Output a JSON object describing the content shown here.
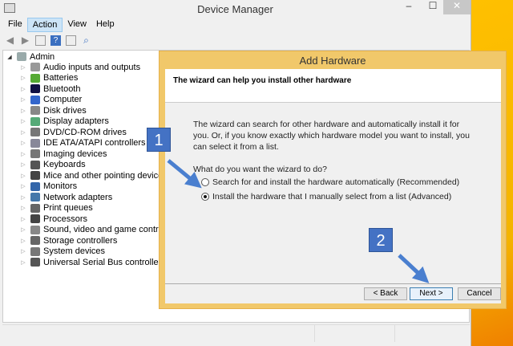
{
  "window": {
    "title": "Device Manager",
    "minimize": "–",
    "maximize": "☐",
    "close": "✕"
  },
  "menu": [
    "File",
    "Action",
    "View",
    "Help"
  ],
  "tree": {
    "root": "Admin",
    "items": [
      "Audio inputs and outputs",
      "Batteries",
      "Bluetooth",
      "Computer",
      "Disk drives",
      "Display adapters",
      "DVD/CD-ROM drives",
      "IDE ATA/ATAPI controllers",
      "Imaging devices",
      "Keyboards",
      "Mice and other pointing devices",
      "Monitors",
      "Network adapters",
      "Print queues",
      "Processors",
      "Sound, video and game controllers",
      "Storage controllers",
      "System devices",
      "Universal Serial Bus controllers"
    ]
  },
  "dialog": {
    "title": "Add Hardware",
    "header": "The wizard can help you install other hardware",
    "description": "The wizard can search for other hardware and automatically install it for you. Or, if you know exactly which hardware model you want to install, you can select it from a list.",
    "question": "What do you want the wizard to do?",
    "options": [
      {
        "label": "Search for and install the hardware automatically (Recommended)",
        "selected": false
      },
      {
        "label": "Install the hardware that I manually select from a list (Advanced)",
        "selected": true
      }
    ],
    "back": "< Back",
    "next": "Next >",
    "cancel": "Cancel"
  },
  "annotations": {
    "step1": "1",
    "step2": "2"
  },
  "colors": {
    "accent": "#4472c4",
    "dialog_frame": "#f1c86a"
  }
}
